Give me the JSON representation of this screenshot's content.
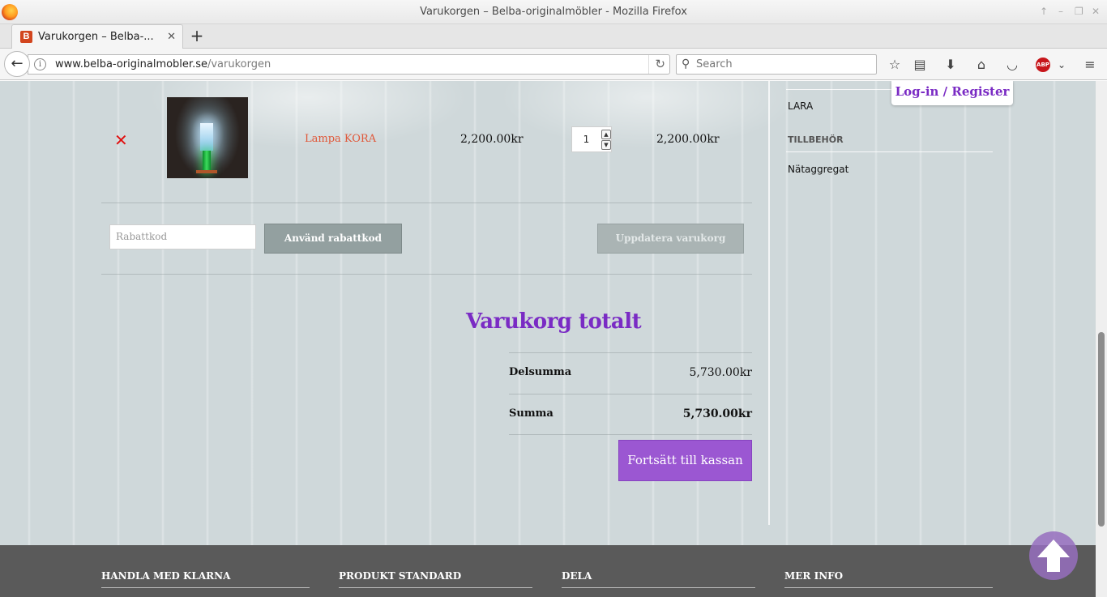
{
  "browser": {
    "window_title": "Varukorgen – Belba-originalmöbler - Mozilla Firefox",
    "tab_title": "Varukorgen – Belba-...",
    "tab_favicon_letter": "B",
    "url_host": "www.belba-originalmobler.se",
    "url_path": "/varukorgen",
    "search_placeholder": "Search",
    "abp_label": "ABP"
  },
  "cart": {
    "item": {
      "name": "Lampa KORA",
      "price": "2,200.00kr",
      "quantity": "1",
      "subtotal": "2,200.00kr"
    },
    "coupon_placeholder": "Rabattkod",
    "coupon_button": "Använd rabattkod",
    "update_button": "Uppdatera varukorg"
  },
  "totals": {
    "title": "Varukorg totalt",
    "subtotal_label": "Delsumma",
    "subtotal_value": "5,730.00kr",
    "total_label": "Summa",
    "total_value": "5,730.00kr",
    "checkout_button": "Fortsätt till kassan"
  },
  "sidebar": {
    "login_label": "Log-in / Register",
    "category_item": "LARA",
    "section_heading": "TILLBEHÖR",
    "section_item": "Nätaggregat"
  },
  "footer": {
    "columns": [
      "HANDLA MED KLARNA",
      "PRODUKT STANDARD",
      "DELA",
      "MER INFO"
    ]
  },
  "colors": {
    "accent_purple": "#7a2bc4",
    "checkout_purple": "#9b57d2",
    "product_link": "#e0583a",
    "remove_red": "#e01010",
    "footer_bg": "#5a5a5a"
  }
}
